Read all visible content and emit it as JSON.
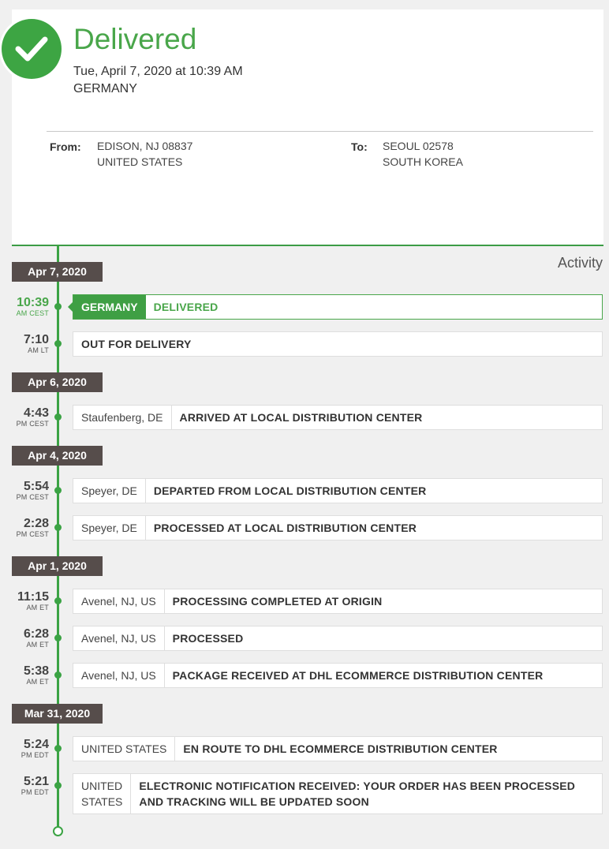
{
  "summary": {
    "status": "Delivered",
    "datetime": "Tue, April 7, 2020 at 10:39 AM",
    "location": "GERMANY",
    "from_label": "From:",
    "from_line1": "EDISON, NJ 08837",
    "from_line2": "UNITED STATES",
    "to_label": "To:",
    "to_line1": "SEOUL 02578",
    "to_line2": "SOUTH KOREA",
    "accent_color": "#49a64a"
  },
  "activity_label": "Activity",
  "dates": [
    "Apr 7, 2020",
    "Apr 6, 2020",
    "Apr 4, 2020",
    "Apr 1, 2020",
    "Mar 31, 2020"
  ],
  "events": [
    {
      "time": "10:39",
      "tz": "AM CEST",
      "place": "GERMANY",
      "desc": "DELIVERED"
    },
    {
      "time": "7:10",
      "tz": "AM LT",
      "place": "",
      "desc": "OUT FOR DELIVERY"
    },
    {
      "time": "4:43",
      "tz": "PM CEST",
      "place": "Staufenberg, DE",
      "desc": "ARRIVED AT LOCAL DISTRIBUTION CENTER"
    },
    {
      "time": "5:54",
      "tz": "PM CEST",
      "place": "Speyer, DE",
      "desc": "DEPARTED FROM LOCAL DISTRIBUTION CENTER"
    },
    {
      "time": "2:28",
      "tz": "PM CEST",
      "place": "Speyer, DE",
      "desc": "PROCESSED AT LOCAL DISTRIBUTION CENTER"
    },
    {
      "time": "11:15",
      "tz": "AM ET",
      "place": "Avenel, NJ, US",
      "desc": "PROCESSING COMPLETED AT ORIGIN"
    },
    {
      "time": "6:28",
      "tz": "AM ET",
      "place": "Avenel, NJ, US",
      "desc": "PROCESSED"
    },
    {
      "time": "5:38",
      "tz": "AM ET",
      "place": "Avenel, NJ, US",
      "desc": "PACKAGE RECEIVED AT DHL ECOMMERCE DISTRIBUTION CENTER"
    },
    {
      "time": "5:24",
      "tz": "PM EDT",
      "place": "UNITED STATES",
      "desc": "EN ROUTE TO DHL ECOMMERCE DISTRIBUTION CENTER"
    },
    {
      "time": "5:21",
      "tz": "PM EDT",
      "place": "UNITED STATES",
      "desc": "ELECTRONIC NOTIFICATION RECEIVED: YOUR ORDER HAS BEEN PROCESSED AND TRACKING WILL BE UPDATED SOON"
    }
  ]
}
